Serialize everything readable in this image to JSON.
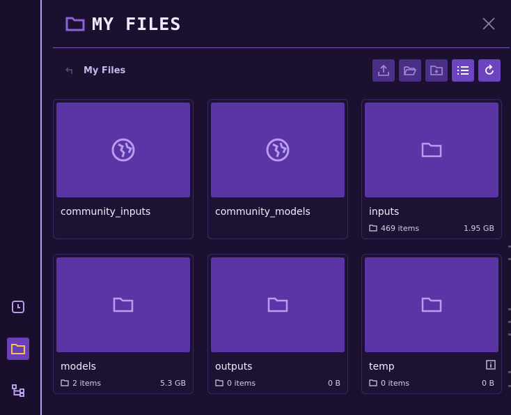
{
  "header": {
    "title": "MY FILES"
  },
  "breadcrumb": {
    "current": "My Files"
  },
  "cards": [
    {
      "name": "community_inputs",
      "icon": "globe-icon"
    },
    {
      "name": "community_models",
      "icon": "globe-icon"
    },
    {
      "name": "inputs",
      "icon": "folder-icon",
      "items": "469 items",
      "size": "1.95 GB"
    },
    {
      "name": "models",
      "icon": "folder-icon",
      "items": "2 items",
      "size": "5.3 GB"
    },
    {
      "name": "outputs",
      "icon": "folder-icon",
      "items": "0 items",
      "size": "0 B"
    },
    {
      "name": "temp",
      "icon": "folder-icon",
      "items": "0 items",
      "size": "0 B"
    }
  ],
  "colors": {
    "accent": "#6b3fb8",
    "thumb": "#5b35a5",
    "rail_icon": "#b79ee8",
    "active_icon": "#f3c94a"
  }
}
